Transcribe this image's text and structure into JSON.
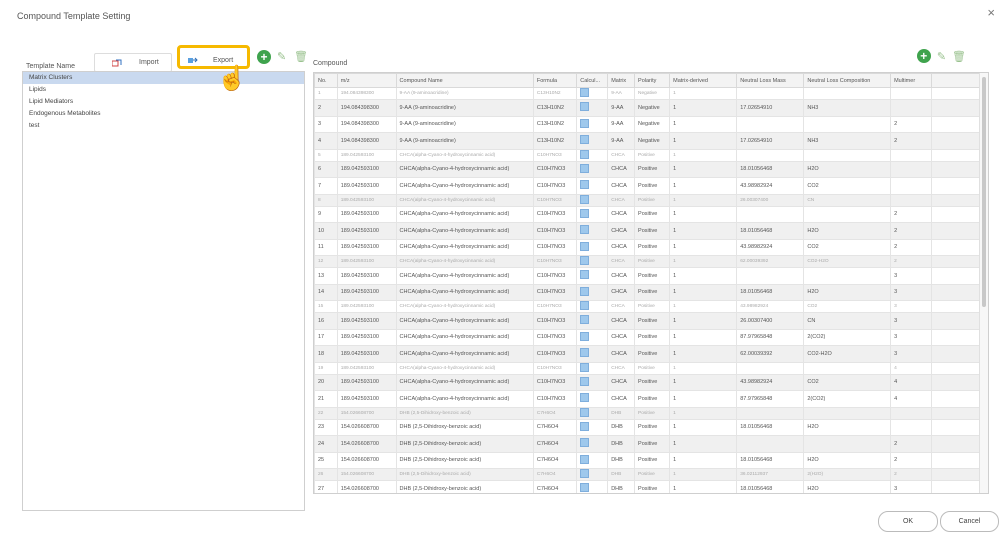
{
  "dialog": {
    "title": "Compound Template Setting",
    "close": "×"
  },
  "left": {
    "header_label": "Template Name",
    "import_label": "Import",
    "export_label": "Export",
    "items": [
      "Matrix Clusters",
      "Lipids",
      "Lipid Mediators",
      "Endogenous Metabolites",
      "test"
    ]
  },
  "right": {
    "label": "Compound",
    "columns": [
      "No.",
      "m/z",
      "Compound Name",
      "Formula",
      "Calcul...",
      "Matrix",
      "Polarity",
      "Matrix-derived",
      "Neutral Loss Mass",
      "Neutral Loss Composition",
      "Multimer"
    ],
    "rows": [
      [
        "1",
        "194.084398300",
        "9-AA (9-aminoacridine)",
        "C13H10N2",
        "",
        "9-AA",
        "Negative",
        "1",
        "",
        "",
        ""
      ],
      [
        "2",
        "194.084398300",
        "9-AA (9-aminoacridine)",
        "C13H10N2",
        "",
        "9-AA",
        "Negative",
        "1",
        "17.02654910",
        "NH3",
        ""
      ],
      [
        "3",
        "194.084398300",
        "9-AA (9-aminoacridine)",
        "C13H10N2",
        "",
        "9-AA",
        "Negative",
        "1",
        "",
        "",
        "2"
      ],
      [
        "4",
        "194.084398300",
        "9-AA (9-aminoacridine)",
        "C13H10N2",
        "",
        "9-AA",
        "Negative",
        "1",
        "17.02654910",
        "NH3",
        "2"
      ],
      [
        "5",
        "189.042593100",
        "CHCA(alpha-Cyano-4-hydroxycinnamic acid)",
        "C10H7NO3",
        "",
        "CHCA",
        "Positive",
        "1",
        "",
        "",
        ""
      ],
      [
        "6",
        "189.042593100",
        "CHCA(alpha-Cyano-4-hydroxycinnamic acid)",
        "C10H7NO3",
        "",
        "CHCA",
        "Positive",
        "1",
        "18.01056468",
        "H2O",
        ""
      ],
      [
        "7",
        "189.042593100",
        "CHCA(alpha-Cyano-4-hydroxycinnamic acid)",
        "C10H7NO3",
        "",
        "CHCA",
        "Positive",
        "1",
        "43.98982924",
        "CO2",
        ""
      ],
      [
        "8",
        "189.042593100",
        "CHCA(alpha-Cyano-4-hydroxycinnamic acid)",
        "C10H7NO3",
        "",
        "CHCA",
        "Positive",
        "1",
        "26.00307400",
        "CN",
        ""
      ],
      [
        "9",
        "189.042593100",
        "CHCA(alpha-Cyano-4-hydroxycinnamic acid)",
        "C10H7NO3",
        "",
        "CHCA",
        "Positive",
        "1",
        "",
        "",
        "2"
      ],
      [
        "10",
        "189.042593100",
        "CHCA(alpha-Cyano-4-hydroxycinnamic acid)",
        "C10H7NO3",
        "",
        "CHCA",
        "Positive",
        "1",
        "18.01056468",
        "H2O",
        "2"
      ],
      [
        "11",
        "189.042593100",
        "CHCA(alpha-Cyano-4-hydroxycinnamic acid)",
        "C10H7NO3",
        "",
        "CHCA",
        "Positive",
        "1",
        "43.98982924",
        "CO2",
        "2"
      ],
      [
        "12",
        "189.042593100",
        "CHCA(alpha-Cyano-4-hydroxycinnamic acid)",
        "C10H7NO3",
        "",
        "CHCA",
        "Positive",
        "1",
        "62.00039392",
        "CO2-H2O",
        "2"
      ],
      [
        "13",
        "189.042593100",
        "CHCA(alpha-Cyano-4-hydroxycinnamic acid)",
        "C10H7NO3",
        "",
        "CHCA",
        "Positive",
        "1",
        "",
        "",
        "3"
      ],
      [
        "14",
        "189.042593100",
        "CHCA(alpha-Cyano-4-hydroxycinnamic acid)",
        "C10H7NO3",
        "",
        "CHCA",
        "Positive",
        "1",
        "18.01056468",
        "H2O",
        "3"
      ],
      [
        "15",
        "189.042593100",
        "CHCA(alpha-Cyano-4-hydroxycinnamic acid)",
        "C10H7NO3",
        "",
        "CHCA",
        "Positive",
        "1",
        "43.98982924",
        "CO2",
        "3"
      ],
      [
        "16",
        "189.042593100",
        "CHCA(alpha-Cyano-4-hydroxycinnamic acid)",
        "C10H7NO3",
        "",
        "CHCA",
        "Positive",
        "1",
        "26.00307400",
        "CN",
        "3"
      ],
      [
        "17",
        "189.042593100",
        "CHCA(alpha-Cyano-4-hydroxycinnamic acid)",
        "C10H7NO3",
        "",
        "CHCA",
        "Positive",
        "1",
        "87.97965848",
        "2(CO2)",
        "3"
      ],
      [
        "18",
        "189.042593100",
        "CHCA(alpha-Cyano-4-hydroxycinnamic acid)",
        "C10H7NO3",
        "",
        "CHCA",
        "Positive",
        "1",
        "62.00039392",
        "CO2-H2O",
        "3"
      ],
      [
        "19",
        "189.042593100",
        "CHCA(alpha-Cyano-4-hydroxycinnamic acid)",
        "C10H7NO3",
        "",
        "CHCA",
        "Positive",
        "1",
        "",
        "",
        "4"
      ],
      [
        "20",
        "189.042593100",
        "CHCA(alpha-Cyano-4-hydroxycinnamic acid)",
        "C10H7NO3",
        "",
        "CHCA",
        "Positive",
        "1",
        "43.98982924",
        "CO2",
        "4"
      ],
      [
        "21",
        "189.042593100",
        "CHCA(alpha-Cyano-4-hydroxycinnamic acid)",
        "C10H7NO3",
        "",
        "CHCA",
        "Positive",
        "1",
        "87.97965848",
        "2(CO2)",
        "4"
      ],
      [
        "22",
        "154.026608700",
        "DHB (2,5-Dihidroxy-benzoic acid)",
        "C7H6O4",
        "",
        "DHB",
        "Positive",
        "1",
        "",
        "",
        ""
      ],
      [
        "23",
        "154.026608700",
        "DHB (2,5-Dihidroxy-benzoic acid)",
        "C7H6O4",
        "",
        "DHB",
        "Positive",
        "1",
        "18.01056468",
        "H2O",
        ""
      ],
      [
        "24",
        "154.026608700",
        "DHB (2,5-Dihidroxy-benzoic acid)",
        "C7H6O4",
        "",
        "DHB",
        "Positive",
        "1",
        "",
        "",
        "2"
      ],
      [
        "25",
        "154.026608700",
        "DHB (2,5-Dihidroxy-benzoic acid)",
        "C7H6O4",
        "",
        "DHB",
        "Positive",
        "1",
        "18.01056468",
        "H2O",
        "2"
      ],
      [
        "26",
        "154.026608700",
        "DHB (2,5-Dihidroxy-benzoic acid)",
        "C7H6O4",
        "",
        "DHB",
        "Positive",
        "1",
        "36.02112937",
        "2(H2O)",
        "2"
      ],
      [
        "27",
        "154.026608700",
        "DHB (2,5-Dihidroxy-benzoic acid)",
        "C7H6O4",
        "",
        "DHB",
        "Positive",
        "1",
        "18.01056468",
        "H2O",
        "3"
      ]
    ],
    "dim_rows": [
      1,
      5,
      8,
      12,
      15,
      19,
      22,
      26
    ]
  },
  "footer": {
    "ok": "OK",
    "cancel": "Cancel"
  },
  "colors": {
    "highlight": "#f6b900",
    "selected_row": "#c9d9ef",
    "add_icon": "#3fa34d",
    "checkbox": "#9ec8ec"
  },
  "icons": {
    "add": "plus-circle-icon",
    "edit": "pencil-icon",
    "delete": "trash-icon",
    "import": "import-icon",
    "export": "export-icon",
    "cursor": "hand-pointer-icon"
  }
}
